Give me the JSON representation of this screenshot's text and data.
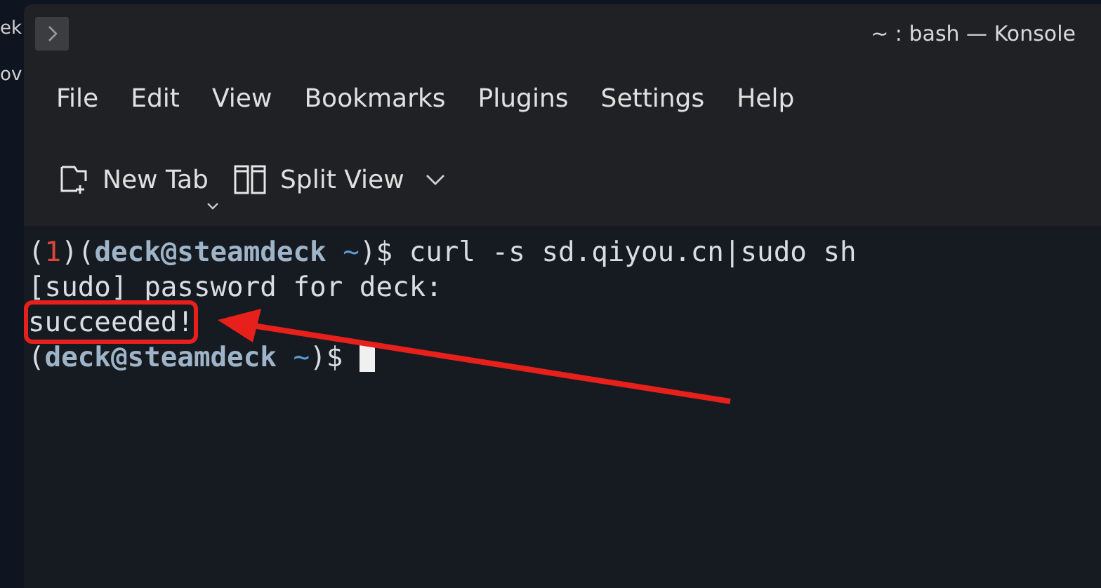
{
  "desktop": {
    "fragments": [
      "ek",
      "ov"
    ]
  },
  "window": {
    "title": "~ : bash — Konsole"
  },
  "menu": [
    "File",
    "Edit",
    "View",
    "Bookmarks",
    "Plugins",
    "Settings",
    "Help"
  ],
  "toolbar": [
    {
      "kind": "new-tab",
      "label": "New Tab"
    },
    {
      "kind": "split-view",
      "label": "Split View"
    }
  ],
  "terminal": {
    "lines": [
      {
        "highlighted": false,
        "cursor": false,
        "segments": [
          {
            "kind": "plain",
            "text": "("
          },
          {
            "kind": "error",
            "text": "1"
          },
          {
            "kind": "plain",
            "text": ")("
          },
          {
            "kind": "user",
            "text": "deck@steamdeck"
          },
          {
            "kind": "path",
            "text": " ~"
          },
          {
            "kind": "plain",
            "text": ")$ curl -s sd.qiyou.cn|sudo sh"
          }
        ]
      },
      {
        "highlighted": false,
        "cursor": false,
        "segments": [
          {
            "kind": "plain",
            "text": "[sudo] password for deck:"
          }
        ]
      },
      {
        "highlighted": true,
        "cursor": false,
        "segments": [
          {
            "kind": "plain",
            "text": "succeeded!"
          }
        ]
      },
      {
        "highlighted": false,
        "cursor": true,
        "segments": [
          {
            "kind": "plain",
            "text": "("
          },
          {
            "kind": "user",
            "text": "deck@steamdeck"
          },
          {
            "kind": "path",
            "text": " ~"
          },
          {
            "kind": "plain",
            "text": ")$ "
          }
        ]
      }
    ]
  }
}
